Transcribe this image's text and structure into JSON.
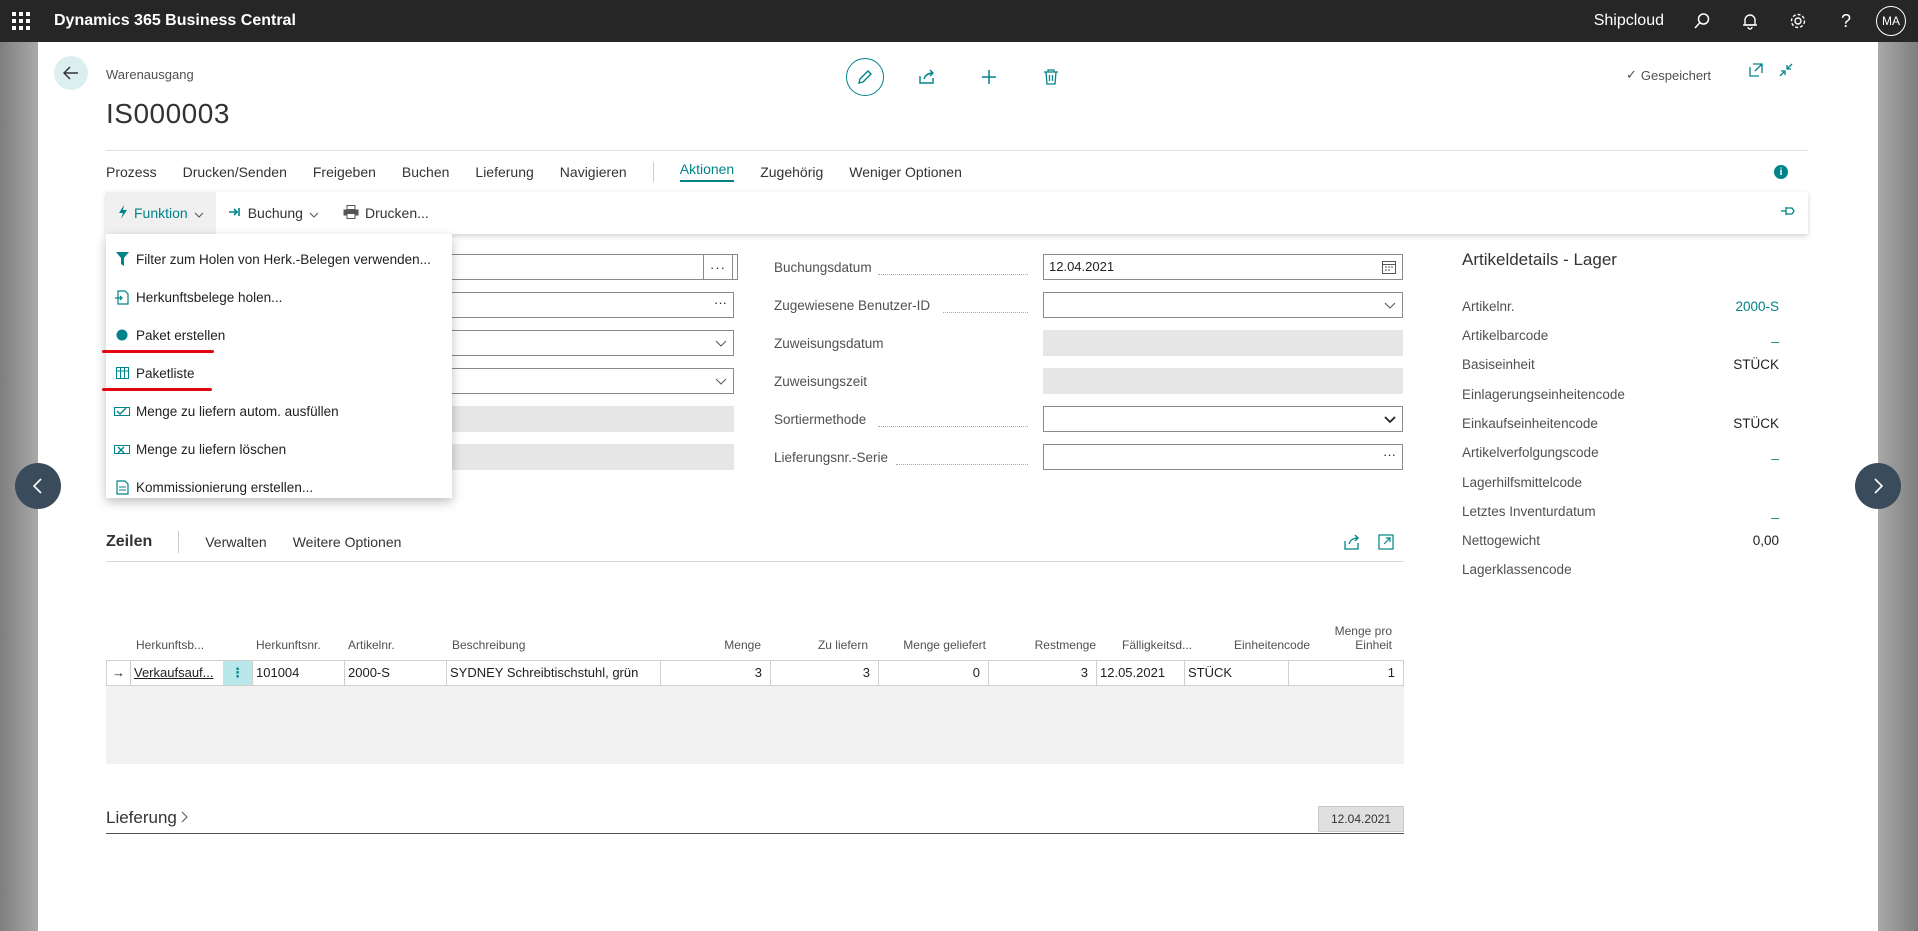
{
  "appbar": {
    "app_name": "Dynamics 365 Business Central",
    "company": "Shipcloud",
    "avatar": "MA",
    "icons": [
      "waffle-icon",
      "search-icon",
      "bell-icon",
      "gear-icon",
      "help-icon"
    ]
  },
  "header": {
    "breadcrumb": "Warenausgang",
    "title": "IS000003",
    "saved": "Gespeichert"
  },
  "menu": {
    "items": [
      "Prozess",
      "Drucken/Senden",
      "Freigeben",
      "Buchen",
      "Lieferung",
      "Navigieren"
    ],
    "active": "Aktionen",
    "more": [
      "Zugehörig",
      "Weniger Optionen"
    ]
  },
  "subbar": {
    "funktion": "Funktion",
    "buchung": "Buchung",
    "drucken": "Drucken..."
  },
  "dropdown": [
    {
      "label": "Filter zum Holen von Herk.-Belegen verwenden...",
      "icon": "filter-icon"
    },
    {
      "label": "Herkunftsbelege holen...",
      "icon": "get-document-icon"
    },
    {
      "label": "Paket erstellen",
      "icon": "circle-icon"
    },
    {
      "label": "Paketliste",
      "icon": "list-icon"
    },
    {
      "label": "Menge zu liefern autom. ausfüllen",
      "icon": "autofill-icon"
    },
    {
      "label": "Menge zu liefern löschen",
      "icon": "delete-qty-icon"
    },
    {
      "label": "Kommissionierung erstellen...",
      "icon": "pick-icon"
    }
  ],
  "general": {
    "buchungsdatum_label": "Buchungsdatum",
    "buchungsdatum": "12.04.2021",
    "benutzer_label": "Zugewiesene Benutzer-ID",
    "zuweisungsdatum_label": "Zuweisungsdatum",
    "zuweisungszeit_label": "Zuweisungszeit",
    "sortiermethode_label": "Sortiermethode",
    "lieferungsnr_label": "Lieferungsnr.-Serie"
  },
  "factbox": {
    "title": "Artikeldetails - Lager",
    "rows": [
      {
        "key": "Artikelnr.",
        "value": "2000-S",
        "link": true
      },
      {
        "key": "Artikelbarcode",
        "value": "_",
        "link": true
      },
      {
        "key": "Basiseinheit",
        "value": "STÜCK",
        "link": false
      },
      {
        "key": "Einlagerungseinheitencode",
        "value": "",
        "link": false
      },
      {
        "key": "Einkaufseinheitencode",
        "value": "STÜCK",
        "link": false
      },
      {
        "key": "Artikelverfolgungscode",
        "value": "_",
        "link": true
      },
      {
        "key": "Lagerhilfsmittelcode",
        "value": "",
        "link": false
      },
      {
        "key": "Letztes Inventurdatum",
        "value": "_",
        "link": true
      },
      {
        "key": "Nettogewicht",
        "value": "0,00",
        "link": false
      },
      {
        "key": "Lagerklassencode",
        "value": "",
        "link": false
      }
    ]
  },
  "lines": {
    "title": "Zeilen",
    "actions": [
      "Verwalten",
      "Weitere Optionen"
    ],
    "columns": [
      "Herkunftsb...",
      "Herkunftsnr.",
      "Artikelnr.",
      "Beschreibung",
      "Menge",
      "Zu liefern",
      "Menge geliefert",
      "Restmenge",
      "Fälligkeitsd...",
      "Einheitencode",
      "Menge pro",
      "Einheit"
    ],
    "row": {
      "herkunftsbeleg": "Verkaufsauf...",
      "herkunftsnr": "101004",
      "artikelnr": "2000-S",
      "beschreibung": "SYDNEY Schreibtischstuhl, grün",
      "menge": "3",
      "zu_liefern": "3",
      "menge_geliefert": "0",
      "restmenge": "3",
      "faelligkeit": "12.05.2021",
      "einheit": "STÜCK",
      "menge_pro_einheit": "1"
    }
  },
  "lieferung": {
    "title": "Lieferung",
    "badge": "12.04.2021"
  },
  "colors": {
    "accent": "#008489",
    "appbar": "#262626",
    "highlight": "#e30613"
  }
}
